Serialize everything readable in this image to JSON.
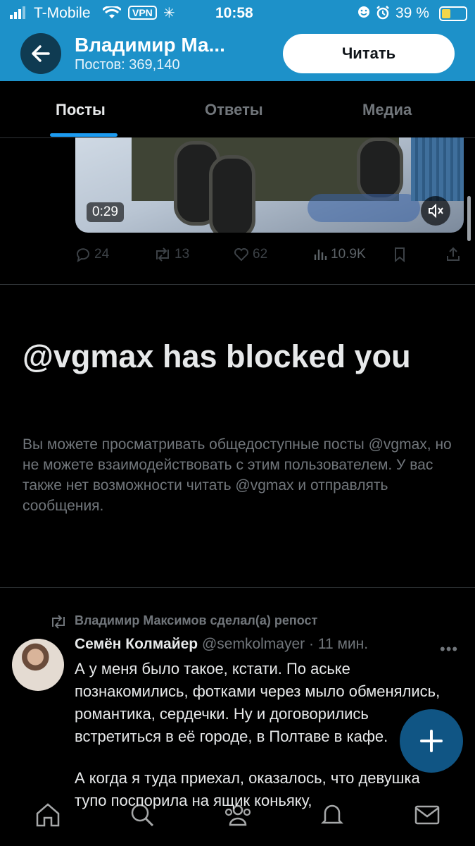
{
  "status_bar": {
    "carrier": "T-Mobile",
    "vpn": "VPN",
    "time": "10:58",
    "battery": "39 %"
  },
  "header": {
    "title": "Владимир Ма...",
    "posts_count": "Постов: 369,140",
    "read_button": "Читать"
  },
  "tabs": [
    {
      "label": "Посты",
      "active": true
    },
    {
      "label": "Ответы",
      "active": false
    },
    {
      "label": "Медиа",
      "active": false
    }
  ],
  "video": {
    "duration": "0:29"
  },
  "actions": {
    "replies": "24",
    "reposts": "13",
    "likes": "62",
    "views": "10.9K"
  },
  "blocked": {
    "title": "@vgmax has blocked you",
    "text": "Вы можете просматривать общедоступные посты @vgmax, но не можете взаимодействовать с этим пользователем. У вас также нет возможности читать @vgmax и отправлять сообщения."
  },
  "repost": {
    "label": "Владимир Максимов сделал(а) репост",
    "author_name": "Семён Колмайер",
    "author_handle": "@semkolmayer",
    "time": "· 11 мин.",
    "text_p1": "А у меня было такое, кстати. По аське познакомились, фотками через мыло обменялись, романтика, сердечки. Ну и договорились встретиться в её городе, в Полтаве в кафе.",
    "text_p2": "А когда я туда приехал, оказалось, что девушка тупо поспорила на ящик коньяку,"
  },
  "colors": {
    "header_bg": "#1d91c9",
    "accent": "#1d9bf0",
    "background": "#000000",
    "muted_text": "#71767b"
  },
  "icons": [
    "back-arrow-icon",
    "wifi-icon",
    "signal-icon",
    "alarm-icon",
    "reply-icon",
    "repost-icon",
    "like-icon",
    "views-icon",
    "bookmark-icon",
    "share-icon",
    "mute-icon",
    "plus-icon",
    "home-icon",
    "search-icon",
    "communities-icon",
    "notifications-icon",
    "messages-icon"
  ]
}
